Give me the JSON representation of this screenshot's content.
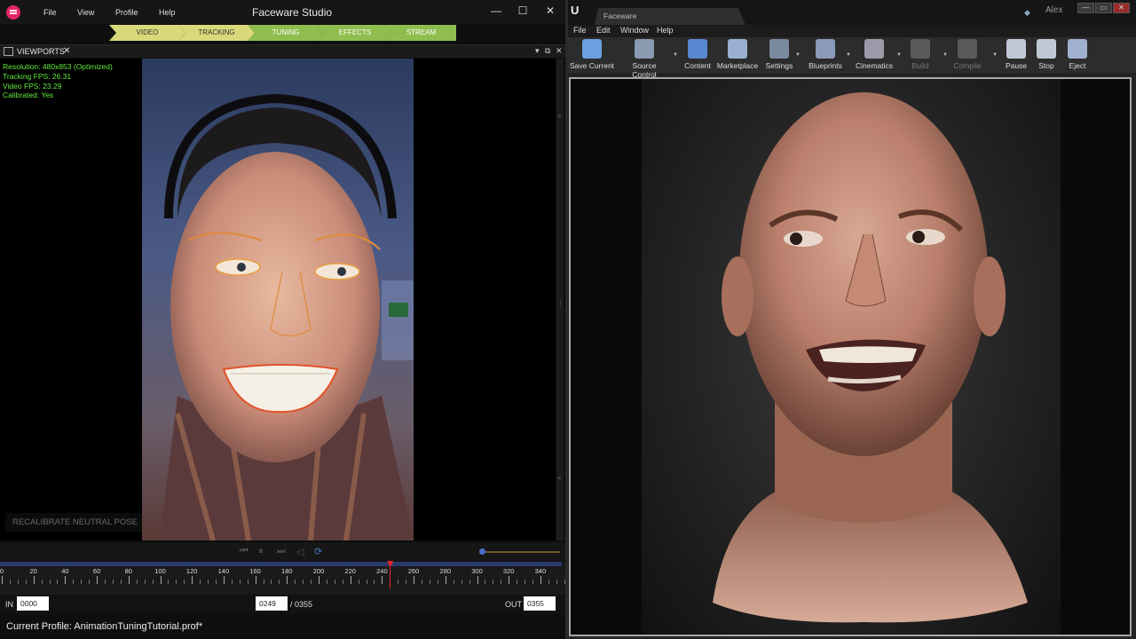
{
  "faceware": {
    "title": "Faceware Studio",
    "menu": [
      "File",
      "View",
      "Profile",
      "Help"
    ],
    "window_controls": [
      "—",
      "☐",
      "✕"
    ],
    "steps": [
      {
        "label": "VIDEO",
        "color": "#d9d97a",
        "text_color": "#333333"
      },
      {
        "label": "TRACKING",
        "color": "#d9d97a",
        "text_color": "#333333"
      },
      {
        "label": "TUNING",
        "color": "#8fbe4e",
        "text_color": "#ffffff"
      },
      {
        "label": "EFFECTS",
        "color": "#8fbe4e",
        "text_color": "#ffffff"
      },
      {
        "label": "STREAM",
        "color": "#8fbe4e",
        "text_color": "#ffffff"
      }
    ],
    "panel_title": "VIEWPORTS",
    "stats": [
      "Resolution: 480x853 (Optimized)",
      "Tracking FPS: 26.31",
      "Video FPS: 23.29",
      "Calibrated: Yes"
    ],
    "recalibrate_label": "RECALIBRATE NEUTRAL POSE",
    "transport_icons": [
      "skip-start-icon",
      "pause-icon",
      "skip-end-icon",
      "step-back-icon",
      "loop-icon"
    ],
    "timeline_ticks": [
      "0",
      "20",
      "40",
      "60",
      "80",
      "100",
      "120",
      "140",
      "160",
      "180",
      "200",
      "220",
      "240",
      "260",
      "280",
      "300",
      "320",
      "340"
    ],
    "current_frame_marker": 245,
    "in_label": "IN",
    "in_value": "0000",
    "current_frame": "0249",
    "total_frames": "/ 0355",
    "out_label": "OUT",
    "out_value": "0355",
    "current_profile": "Current Profile: AnimationTuningTutorial.prof*"
  },
  "unreal": {
    "tab_title": "Faceware",
    "user": "Alex",
    "menu": [
      "File",
      "Edit",
      "Window",
      "Help"
    ],
    "toolbar": [
      {
        "label": "Save Current",
        "icon": "save-icon",
        "color": "#6aa0e0",
        "enabled": true
      },
      {
        "label": "Source Control",
        "icon": "source-control-icon",
        "color": "#8a9ab0",
        "enabled": true
      },
      {
        "label": "Content",
        "icon": "content-icon",
        "color": "#5a88d0",
        "enabled": true
      },
      {
        "label": "Marketplace",
        "icon": "marketplace-icon",
        "color": "#9ab0d0",
        "enabled": true
      },
      {
        "label": "Settings",
        "icon": "settings-icon",
        "color": "#7a8aa0",
        "enabled": true
      },
      {
        "label": "Blueprints",
        "icon": "blueprints-icon",
        "color": "#8a9ab8",
        "enabled": true
      },
      {
        "label": "Cinematics",
        "icon": "cinematics-icon",
        "color": "#9a9aa8",
        "enabled": true
      },
      {
        "label": "Build",
        "icon": "build-icon",
        "color": "#5a5a5a",
        "enabled": false
      },
      {
        "label": "Compile",
        "icon": "compile-icon",
        "color": "#5a5a5a",
        "enabled": false
      },
      {
        "label": "Pause",
        "icon": "pause-icon",
        "color": "#c0c8d8",
        "enabled": true
      },
      {
        "label": "Stop",
        "icon": "stop-icon",
        "color": "#c0c8d8",
        "enabled": true
      },
      {
        "label": "Eject",
        "icon": "eject-icon",
        "color": "#a0b0d0",
        "enabled": true
      }
    ]
  }
}
